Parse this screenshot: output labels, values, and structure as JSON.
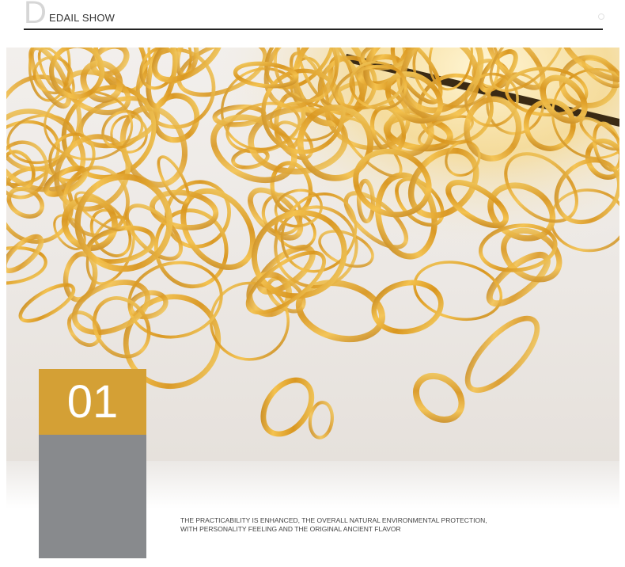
{
  "header": {
    "big_letter": "D",
    "title_rest": "EDAIL SHOW"
  },
  "photo": {
    "subject": "gold-ring-chandelier",
    "accent_color": "#d4a035",
    "ring_color": "#c98d1e"
  },
  "badge": {
    "number": "01",
    "gold_color": "#d4a035",
    "gray_color": "#888a8d"
  },
  "caption": {
    "line1": "THE PRACTICABILITY IS ENHANCED, THE OVERALL NATURAL ENVIRONMENTAL PROTECTION,",
    "line2": "WITH PERSONALITY FEELING AND THE ORIGINAL ANCIENT FLAVOR"
  }
}
